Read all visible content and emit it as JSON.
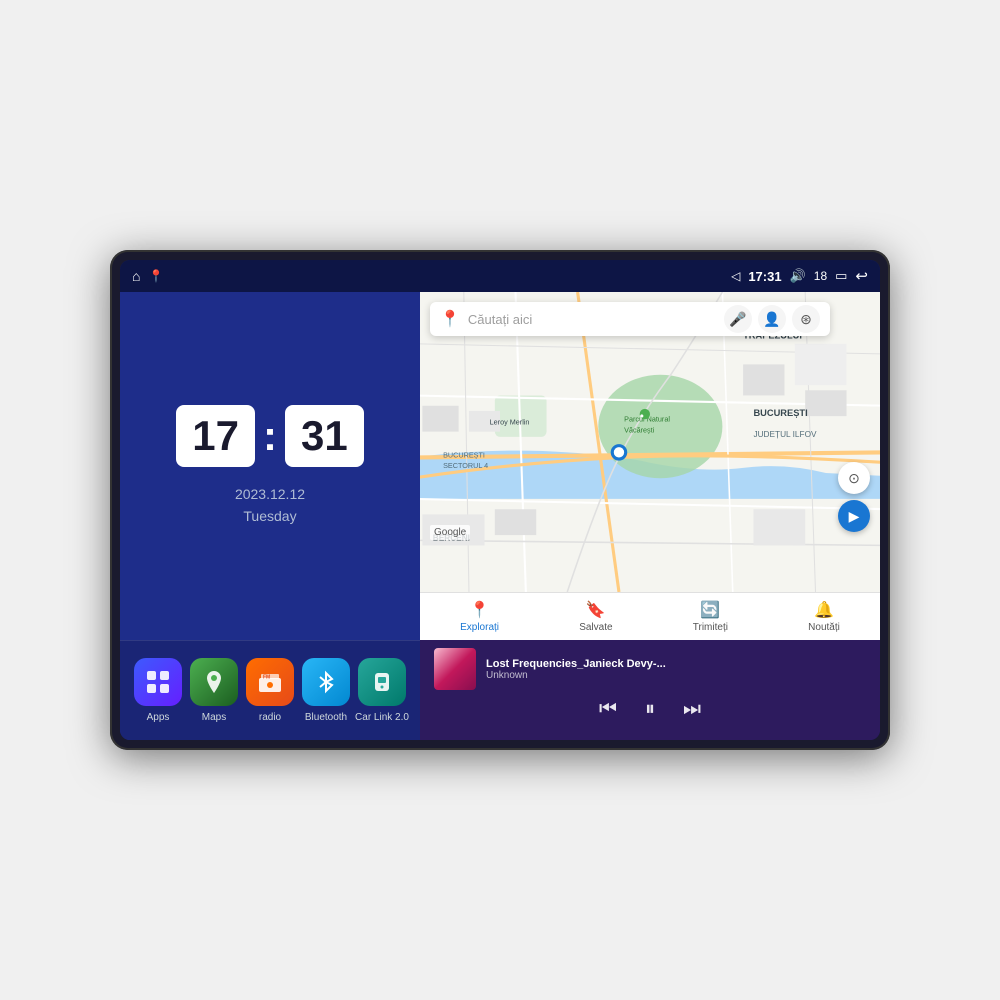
{
  "device": {
    "status_bar": {
      "left_icons": [
        "home",
        "maps"
      ],
      "time": "17:31",
      "volume_icon": "🔊",
      "battery_level": "18",
      "battery_icon": "🔋",
      "back_icon": "↩"
    },
    "clock": {
      "hour": "17",
      "minute": "31",
      "date": "2023.12.12",
      "day": "Tuesday"
    },
    "apps": [
      {
        "id": "apps",
        "label": "Apps",
        "icon": "⊞",
        "class": "apps"
      },
      {
        "id": "maps",
        "label": "Maps",
        "icon": "📍",
        "class": "maps"
      },
      {
        "id": "radio",
        "label": "radio",
        "icon": "📻",
        "class": "radio"
      },
      {
        "id": "bluetooth",
        "label": "Bluetooth",
        "icon": "🔵",
        "class": "bluetooth"
      },
      {
        "id": "carlink",
        "label": "Car Link 2.0",
        "icon": "📱",
        "class": "carlink"
      }
    ],
    "map": {
      "search_placeholder": "Căutați aici",
      "nav_items": [
        {
          "label": "Explorați",
          "icon": "📍",
          "active": true
        },
        {
          "label": "Salvate",
          "icon": "🔖",
          "active": false
        },
        {
          "label": "Trimiteți",
          "icon": "🔄",
          "active": false
        },
        {
          "label": "Noutăți",
          "icon": "🔔",
          "active": false
        }
      ],
      "labels": [
        "TRAPEZULUI",
        "BUCUREȘTI",
        "JUDEȚUL ILFOV",
        "BERCENI",
        "BUCUREȘTI SECTORUL 4",
        "Parcul Natural Văcărești",
        "Leroy Merlin"
      ]
    },
    "music": {
      "title": "Lost Frequencies_Janieck Devy-...",
      "artist": "Unknown",
      "controls": {
        "prev": "⏮",
        "play_pause": "⏸",
        "next": "⏭"
      }
    }
  }
}
